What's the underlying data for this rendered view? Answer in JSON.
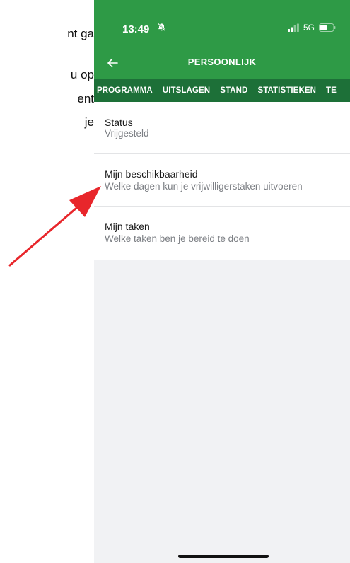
{
  "document": {
    "lines": [
      "nt ga",
      "u op",
      "ent",
      "je",
      ""
    ]
  },
  "phone": {
    "status_bar": {
      "time": "13:49",
      "network": "5G",
      "icons": [
        "bell-off-icon",
        "signal-icon",
        "battery-icon"
      ]
    },
    "title_bar": {
      "title": "PERSOONLIJK",
      "back_icon": "arrow-left-icon"
    },
    "tabs": [
      "PROGRAMMA",
      "UITSLAGEN",
      "STAND",
      "STATISTIEKEN",
      "TE"
    ],
    "items": [
      {
        "title": "Status",
        "subtitle": "Vrijgesteld"
      },
      {
        "title": "Mijn beschikbaarheid",
        "subtitle": "Welke dagen kun je vrijwilligerstaken uitvoeren"
      },
      {
        "title": "Mijn taken",
        "subtitle": "Welke taken ben je bereid te doen"
      }
    ]
  },
  "colors": {
    "header_green": "#2e9a46",
    "tabs_green": "#1d7038",
    "annotation_arrow": "#e8262b"
  }
}
